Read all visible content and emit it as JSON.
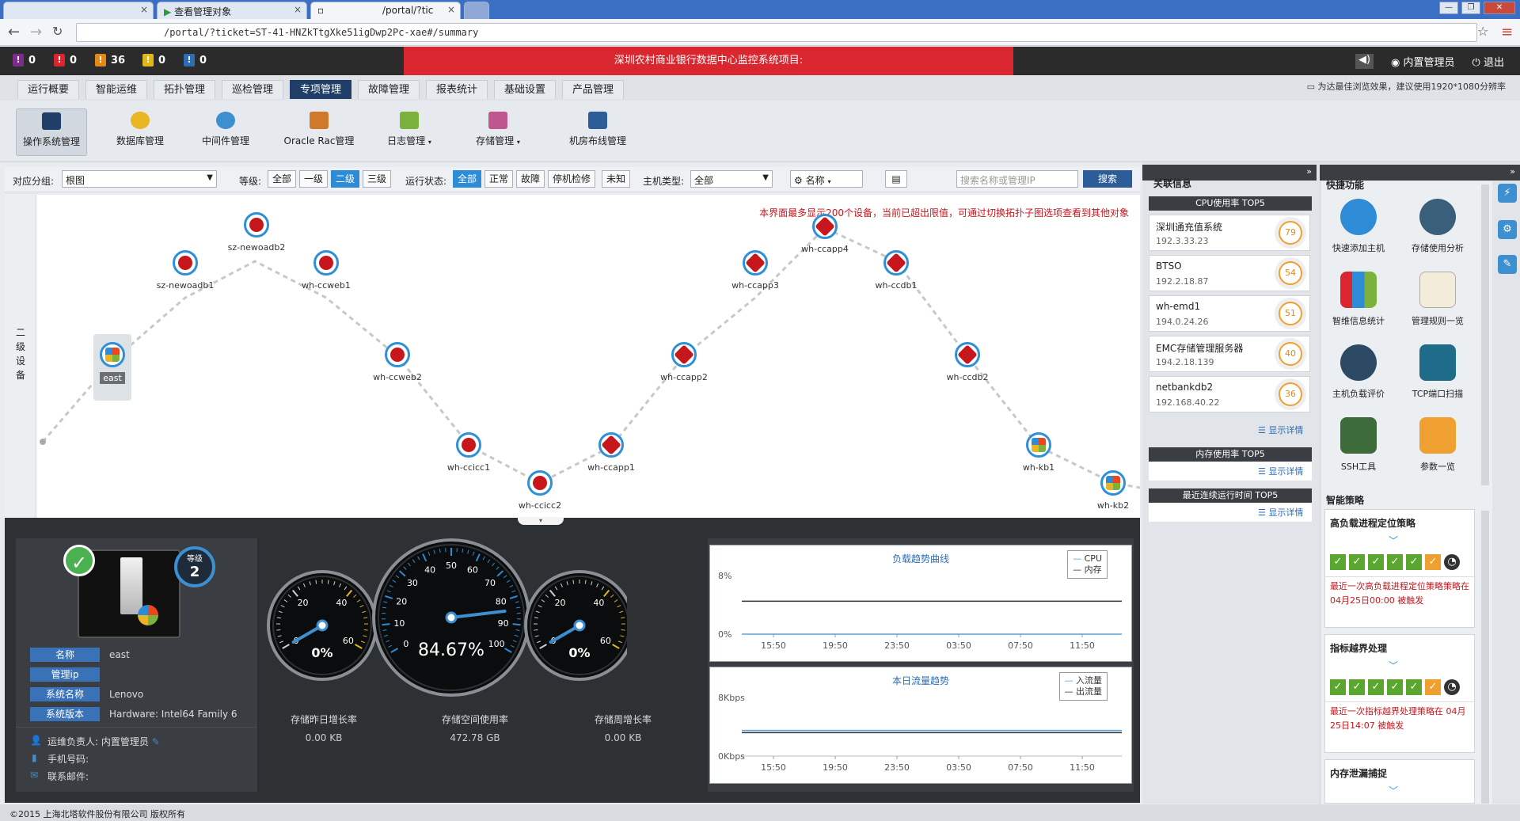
{
  "browser": {
    "tabs": [
      {
        "label": ""
      },
      {
        "label": "查看管理对象"
      },
      {
        "label": "/portal/?tic"
      }
    ],
    "url": "/portal/?ticket=ST-41-HNZkTtgXke51igDwp2Pc-xae#/summary"
  },
  "header": {
    "counts": [
      {
        "value": "0",
        "color": "#7c2d8c"
      },
      {
        "value": "0",
        "color": "#d9262f"
      },
      {
        "value": "36",
        "color": "#e08a1a"
      },
      {
        "value": "0",
        "color": "#e0b81a"
      },
      {
        "value": "0",
        "color": "#2e6db4"
      }
    ],
    "alert": "深圳农村商业银行数据中心监控系统项目:",
    "user": "内置管理员",
    "logout": "退出"
  },
  "mainnav": {
    "tabs": [
      "运行概要",
      "智能运维",
      "拓扑管理",
      "巡检管理",
      "专项管理",
      "故障管理",
      "报表统计",
      "基础设置",
      "产品管理"
    ],
    "active": "专项管理",
    "tip": "为达最佳浏览效果，建议使用1920*1080分辨率"
  },
  "subnav": {
    "items": [
      "操作系统管理",
      "数据库管理",
      "中间件管理",
      "Oracle Rac管理",
      "日志管理",
      "存储管理",
      "机房布线管理"
    ]
  },
  "filter": {
    "group_label": "对应分组:",
    "group_value": "根图",
    "level_label": "等级:",
    "levels": [
      "全部",
      "一级",
      "二级",
      "三级"
    ],
    "status_label": "运行状态:",
    "statuses": [
      "全部",
      "正常",
      "故障",
      "停机检修",
      "未知"
    ],
    "host_label": "主机类型:",
    "host_value": "全部",
    "sort_label": "名称",
    "search_placeholder": "搜索名称或管理IP",
    "search_btn": "搜索"
  },
  "topology": {
    "level_text": "二级设备",
    "note": "本界面最多显示200个设备，当前已超出限值，可通过切换拓扑子图选项查看到其他对象",
    "nodes": [
      {
        "name": "east",
        "type": "windows"
      },
      {
        "name": "sz-newoadb1",
        "type": "redhat"
      },
      {
        "name": "sz-newoadb2",
        "type": "redhat"
      },
      {
        "name": "wh-ccweb1",
        "type": "redhat"
      },
      {
        "name": "wh-ccweb2",
        "type": "redhat"
      },
      {
        "name": "wh-ccicc1",
        "type": "redhat"
      },
      {
        "name": "wh-ccicc2",
        "type": "redhat"
      },
      {
        "name": "wh-ccapp1",
        "type": "unix"
      },
      {
        "name": "wh-ccapp2",
        "type": "unix"
      },
      {
        "name": "wh-ccapp3",
        "type": "unix"
      },
      {
        "name": "wh-ccapp4",
        "type": "unix"
      },
      {
        "name": "wh-ccdb1",
        "type": "unix"
      },
      {
        "name": "wh-ccdb2",
        "type": "unix"
      },
      {
        "name": "wh-kb1",
        "type": "windows"
      },
      {
        "name": "wh-kb2",
        "type": "windows"
      }
    ]
  },
  "device": {
    "level_label": "等级",
    "level": "2",
    "fields": [
      {
        "key": "名称",
        "value": "east"
      },
      {
        "key": "管理ip",
        "value": ""
      },
      {
        "key": "系统名称",
        "value": "Lenovo"
      },
      {
        "key": "系统版本",
        "value": "Hardware: Intel64 Family 6"
      }
    ],
    "owner_label": "运维负责人:",
    "owner": "内置管理员",
    "phone_label": "手机号码:",
    "email_label": "联系邮件:"
  },
  "gauges": [
    {
      "name": "存储昨日增长率",
      "display": "0%",
      "sub": "0.00 KB",
      "value": 0
    },
    {
      "name": "存储空间使用率",
      "display": "84.67%",
      "sub": "472.78 GB",
      "value": 84.67
    },
    {
      "name": "存储周增长率",
      "display": "0%",
      "sub": "0.00 KB",
      "value": 0
    }
  ],
  "gauge_scale_small": [
    "0",
    "20",
    "40",
    "60"
  ],
  "gauge_scale_big": [
    "0",
    "10",
    "20",
    "30",
    "40",
    "50",
    "60",
    "70",
    "80",
    "90",
    "100"
  ],
  "chart_data": [
    {
      "type": "line",
      "title": "负载趋势曲线",
      "x": [
        "15:50",
        "19:50",
        "23:50",
        "03:50",
        "07:50",
        "11:50"
      ],
      "ylim": [
        "0%",
        "8%"
      ],
      "series": [
        {
          "name": "CPU",
          "color": "#5aa0d8",
          "values": [
            0,
            0,
            0,
            0,
            0,
            0
          ]
        },
        {
          "name": "内存",
          "color": "#333333",
          "values": [
            4.5,
            4.5,
            4.5,
            4.5,
            4.5,
            4.5
          ]
        }
      ]
    },
    {
      "type": "line",
      "title": "本日流量趋势",
      "x": [
        "15:50",
        "19:50",
        "23:50",
        "03:50",
        "07:50",
        "11:50"
      ],
      "ylim": [
        "0Kbps",
        "8Kbps"
      ],
      "series": [
        {
          "name": "入流量",
          "color": "#5aa0d8",
          "values": [
            3.5,
            3.5,
            3.5,
            3.5,
            3.5,
            3.5
          ]
        },
        {
          "name": "出流量",
          "color": "#333333",
          "values": [
            3.2,
            3.2,
            3.2,
            3.2,
            3.2,
            3.2
          ]
        }
      ]
    }
  ],
  "right": {
    "related_title": "关联信息",
    "cpu_title": "CPU使用率 TOP5",
    "cpu_top": [
      {
        "name": "深圳通充值系统",
        "ip": "192.3.33.23",
        "value": "79"
      },
      {
        "name": "BTSO",
        "ip": "192.2.18.87",
        "value": "54"
      },
      {
        "name": "wh-emd1",
        "ip": "194.0.24.26",
        "value": "51"
      },
      {
        "name": "EMC存储管理服务器",
        "ip": "194.2.18.139",
        "value": "40"
      },
      {
        "name": "netbankdb2",
        "ip": "192.168.40.22",
        "value": "36"
      }
    ],
    "detail_label": "显示详情",
    "mem_title": "内存使用率 TOP5",
    "uptime_title": "最近连续运行时间 TOP5",
    "quick_title": "快捷功能",
    "quick": [
      "快速添加主机",
      "存储使用分析",
      "智维信息统计",
      "管理规则一览",
      "主机负载评价",
      "TCP端口扫描",
      "SSH工具",
      "参数一览"
    ],
    "strategy_title": "智能策略",
    "strategies": [
      {
        "title": "高负载进程定位策略",
        "msg": "最近一次高负载进程定位策略策略在 04月25日00:00 被触发"
      },
      {
        "title": "指标越界处理",
        "msg": "最近一次指标越界处理策略在 04月25日14:07 被触发"
      },
      {
        "title": "内存泄漏捕捉",
        "msg": ""
      }
    ]
  },
  "footer": "©2015 上海北塔软件股份有限公司 版权所有"
}
